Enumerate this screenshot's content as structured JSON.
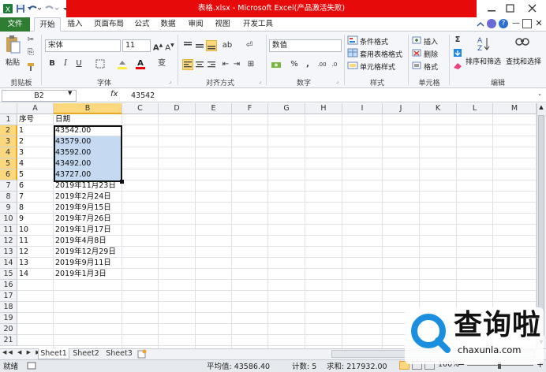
{
  "title_bar": {
    "title": "表格.xlsx - Microsoft Excel(产品激活失败)",
    "window_controls": [
      "minimize-icon",
      "restore-icon",
      "close-icon"
    ]
  },
  "tabs": [
    "文件",
    "开始",
    "插入",
    "页面布局",
    "公式",
    "数据",
    "审阅",
    "视图",
    "开发工具"
  ],
  "ribbon": {
    "groups": {
      "clipboard": "剪贴板",
      "font": "字体",
      "alignment": "对齐方式",
      "number": "数字",
      "styles": "样式",
      "cells": "单元格",
      "editing": "编辑"
    },
    "paste_label": "粘贴",
    "font_name": "宋体",
    "font_size": "11",
    "bold": "B",
    "italic": "I",
    "underline": "U",
    "number_format": "数值",
    "conditional_format": "条件格式",
    "table_format": "套用表格格式",
    "cell_styles": "单元格样式",
    "insert": "插入",
    "delete": "删除",
    "format": "格式",
    "sort_filter": "排序和筛选",
    "find_select": "查找和选择",
    "currency_symbol": "%",
    "comma_symbol": ","
  },
  "formula_bar": {
    "name_box": "B2",
    "fx": "fx",
    "value": "43542"
  },
  "columns": [
    "A",
    "B",
    "C",
    "D",
    "E",
    "F",
    "G",
    "H",
    "I",
    "J",
    "K",
    "L",
    "M"
  ],
  "rows": [
    {
      "num": "1",
      "a": "序号",
      "b": "日期"
    },
    {
      "num": "2",
      "a": "1",
      "b": "43542.00"
    },
    {
      "num": "3",
      "a": "2",
      "b": "43579.00"
    },
    {
      "num": "4",
      "a": "3",
      "b": "43592.00"
    },
    {
      "num": "5",
      "a": "4",
      "b": "43492.00"
    },
    {
      "num": "6",
      "a": "5",
      "b": "43727.00"
    },
    {
      "num": "7",
      "a": "6",
      "b": "2019年11月23日"
    },
    {
      "num": "8",
      "a": "7",
      "b": "2019年2月24日"
    },
    {
      "num": "9",
      "a": "8",
      "b": "2019年9月15日"
    },
    {
      "num": "10",
      "a": "9",
      "b": "2019年7月26日"
    },
    {
      "num": "11",
      "a": "10",
      "b": "2019年1月17日"
    },
    {
      "num": "12",
      "a": "11",
      "b": "2019年4月8日"
    },
    {
      "num": "13",
      "a": "12",
      "b": "2019年12月29日"
    },
    {
      "num": "14",
      "a": "13",
      "b": "2019年9月11日"
    },
    {
      "num": "15",
      "a": "14",
      "b": "2019年1月3日"
    },
    {
      "num": "16",
      "a": "",
      "b": ""
    },
    {
      "num": "17",
      "a": "",
      "b": ""
    },
    {
      "num": "18",
      "a": "",
      "b": ""
    },
    {
      "num": "19",
      "a": "",
      "b": ""
    },
    {
      "num": "20",
      "a": "",
      "b": ""
    },
    {
      "num": "21",
      "a": "",
      "b": ""
    }
  ],
  "sheets": [
    "Sheet1",
    "Sheet2",
    "Sheet3"
  ],
  "status": {
    "mode": "就绪",
    "average": "平均值: 43586.40",
    "count": "计数: 5",
    "sum": "求和: 217932.00",
    "zoom": "100%"
  },
  "watermark": {
    "name": "查询啦",
    "url": "chaxunla.com"
  },
  "colors": {
    "excel_green": "#2e7d32",
    "title_red": "#e60a0a",
    "selection_fill": "#c5d9f1",
    "header_highlight": "#fbd77d",
    "watermark_blue": "#1a8fe0"
  }
}
